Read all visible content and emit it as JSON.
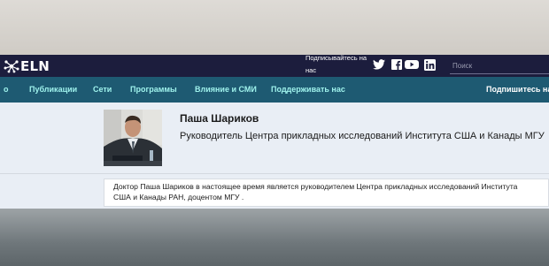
{
  "brand": {
    "logo_text": "ELN"
  },
  "header": {
    "subscribe_prompt": "Подписывайтесь на нас",
    "social": [
      "twitter-icon",
      "facebook-icon",
      "youtube-icon",
      "linkedin-icon"
    ],
    "search_placeholder": "Поиск"
  },
  "nav": {
    "items": [
      "о",
      "Публикации",
      "Сети",
      "Программы",
      "Влияние и СМИ",
      "Поддерживать нас"
    ],
    "cta": "Подпишитесь на"
  },
  "profile": {
    "name": "Паша Шариков",
    "title": "Руководитель Центра прикладных исследований Института США и Канады МГУ",
    "bio": "Доктор Паша Шариков в настоящее время является руководителем Центра прикладных исследований Института США и  Канады РАН, доцентом  МГУ ."
  },
  "colors": {
    "header_bg": "#1c1d3d",
    "nav_bg": "#1e5a72",
    "nav_text": "#9ff2ec",
    "page_bg": "#e9eef5"
  }
}
